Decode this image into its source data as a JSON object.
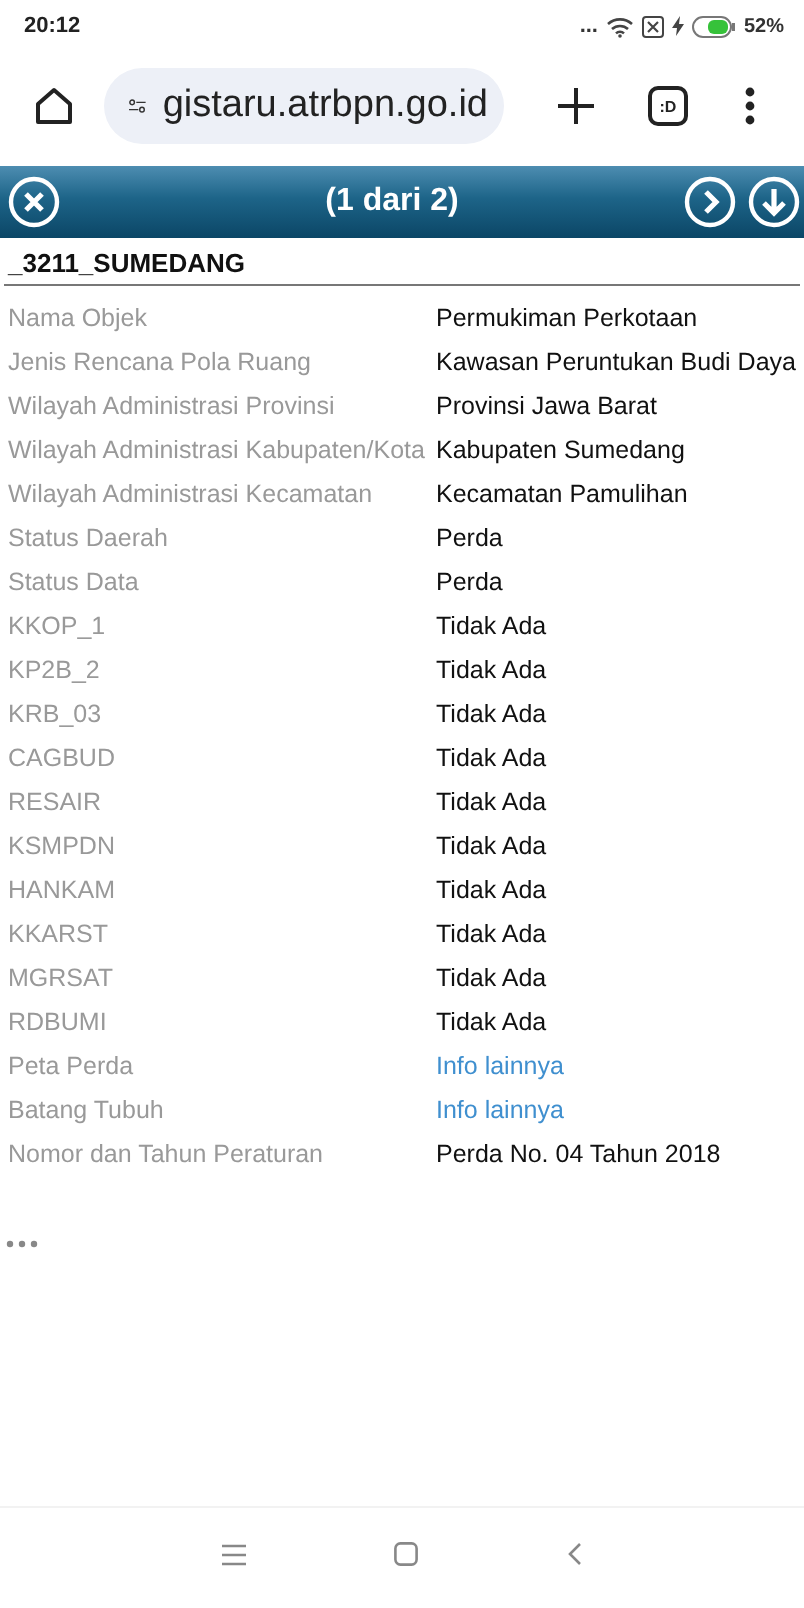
{
  "status_bar": {
    "time": "20:12",
    "dots": "...",
    "battery": "52%"
  },
  "browser": {
    "url": "gistaru.atrbpn.go.id",
    "tabs_label": ":D"
  },
  "popup": {
    "counter": "(1 dari 2)",
    "title": "_3211_SUMEDANG",
    "rows": [
      {
        "label": "Nama Objek",
        "value": "Permukiman Perkotaan",
        "kind": "text"
      },
      {
        "label": "Jenis Rencana Pola Ruang",
        "value": "Kawasan Peruntukan Budi Daya",
        "kind": "text"
      },
      {
        "label": "Wilayah Administrasi Provinsi",
        "value": "Provinsi Jawa Barat",
        "kind": "text"
      },
      {
        "label": "Wilayah Administrasi Kabupaten/Kota",
        "value": "Kabupaten Sumedang",
        "kind": "text"
      },
      {
        "label": "Wilayah Administrasi Kecamatan",
        "value": "Kecamatan Pamulihan",
        "kind": "text"
      },
      {
        "label": "Status Daerah",
        "value": "Perda",
        "kind": "text"
      },
      {
        "label": "Status Data",
        "value": "Perda",
        "kind": "text"
      },
      {
        "label": "KKOP_1",
        "value": "Tidak Ada",
        "kind": "text"
      },
      {
        "label": "KP2B_2",
        "value": "Tidak Ada",
        "kind": "text"
      },
      {
        "label": "KRB_03",
        "value": "Tidak Ada",
        "kind": "text"
      },
      {
        "label": "CAGBUD",
        "value": "Tidak Ada",
        "kind": "text"
      },
      {
        "label": "RESAIR",
        "value": "Tidak Ada",
        "kind": "text"
      },
      {
        "label": "KSMPDN",
        "value": "Tidak Ada",
        "kind": "text"
      },
      {
        "label": "HANKAM",
        "value": "Tidak Ada",
        "kind": "text"
      },
      {
        "label": "KKARST",
        "value": "Tidak Ada",
        "kind": "text"
      },
      {
        "label": "MGRSAT",
        "value": "Tidak Ada",
        "kind": "text"
      },
      {
        "label": "RDBUMI",
        "value": "Tidak Ada",
        "kind": "text"
      },
      {
        "label": "Peta Perda",
        "value": "Info lainnya",
        "kind": "link"
      },
      {
        "label": "Batang Tubuh",
        "value": "Info lainnya",
        "kind": "link"
      },
      {
        "label": "Nomor dan Tahun Peraturan",
        "value": "Perda No. 04 Tahun 2018",
        "kind": "text"
      }
    ]
  }
}
